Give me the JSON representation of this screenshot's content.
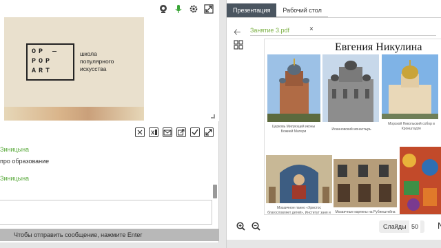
{
  "video": {
    "logo_lines": [
      "OP —",
      "POP",
      "ART"
    ],
    "school_text": "школа\nпопулярного\nискусства",
    "icons": [
      "webcam-icon",
      "microphone-icon",
      "settings-gear-icon",
      "fullscreen-icon"
    ]
  },
  "chat": {
    "toolbar_icons": [
      "clear-icon",
      "excel-export-icon",
      "email-icon",
      "popout-icon",
      "checklist-icon",
      "fullscreen-icon"
    ],
    "messages": [
      {
        "author": "Зиницына",
        "text": "про образование"
      },
      {
        "author": "Зиницына",
        "text": ""
      }
    ],
    "send_hint": "Чтобы отправить сообщение, нажмите Enter"
  },
  "presentation": {
    "tabs": [
      {
        "label": "Презентация",
        "active": true
      },
      {
        "label": "Рабочий стол",
        "active": false
      }
    ],
    "file_name": "Занятие 3.pdf",
    "file_close": "×",
    "slide": {
      "title": "Евгения Никулина",
      "captions": [
        "Церковь Милующей иконы Божией Матери",
        "Иоанновский монастырь",
        "Морской Никольский собор в Кронштадте",
        "Мозаичное панно «Христос благословляет детей», Институт заня и Зайчинкания",
        "Мозаичные картины на Рубинштейна"
      ]
    },
    "slides_label": "Слайды",
    "slides_count": "50",
    "next_label": "N"
  },
  "colors": {
    "accent_green": "#58a93a",
    "tab_active_bg": "#4a5560",
    "send_bar_bg": "#b8b8b8",
    "file_green": "#7bb043"
  }
}
